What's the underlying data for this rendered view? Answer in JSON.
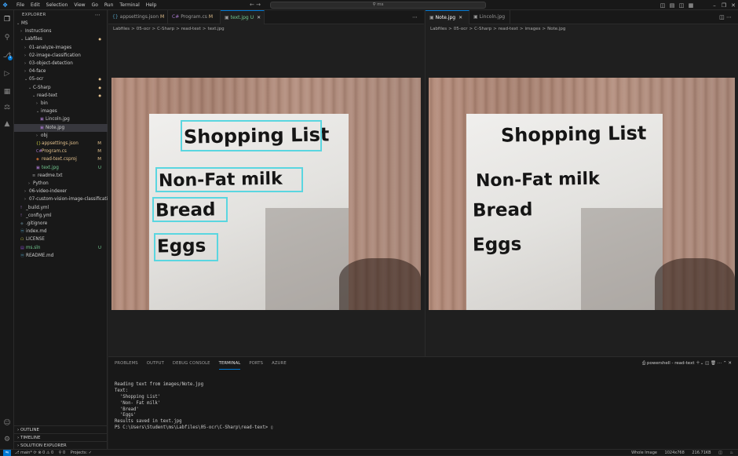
{
  "title_bar": {
    "menu": [
      "File",
      "Edit",
      "Selection",
      "View",
      "Go",
      "Run",
      "Terminal",
      "Help"
    ],
    "search_text": "ms"
  },
  "explorer": {
    "header": "EXPLORER",
    "items": [
      {
        "label": "MS",
        "status": ""
      },
      {
        "label": "Instructions",
        "status": ""
      },
      {
        "label": "Labfiles",
        "status": "●"
      },
      {
        "label": "01-analyze-images",
        "status": ""
      },
      {
        "label": "02-image-classification",
        "status": ""
      },
      {
        "label": "03-object-detection",
        "status": ""
      },
      {
        "label": "04-face",
        "status": ""
      },
      {
        "label": "05-ocr",
        "status": "●"
      },
      {
        "label": "C-Sharp",
        "status": "●"
      },
      {
        "label": "read-text",
        "status": "●"
      },
      {
        "label": "bin",
        "status": ""
      },
      {
        "label": "images",
        "status": ""
      },
      {
        "label": "Lincoln.jpg",
        "status": ""
      },
      {
        "label": "Note.jpg",
        "status": ""
      },
      {
        "label": "obj",
        "status": ""
      },
      {
        "label": "appsettings.json",
        "status": "M"
      },
      {
        "label": "Program.cs",
        "status": "M"
      },
      {
        "label": "read-text.csproj",
        "status": "M"
      },
      {
        "label": "text.jpg",
        "status": "U"
      },
      {
        "label": "readme.txt",
        "status": ""
      },
      {
        "label": "Python",
        "status": ""
      },
      {
        "label": "06-video-indexer",
        "status": ""
      },
      {
        "label": "07-custom-vision-image-classificati...",
        "status": ""
      },
      {
        "label": "_build.yml",
        "status": ""
      },
      {
        "label": "_config.yml",
        "status": ""
      },
      {
        "label": ".gitignore",
        "status": ""
      },
      {
        "label": "index.md",
        "status": ""
      },
      {
        "label": "LICENSE",
        "status": ""
      },
      {
        "label": "ms.sln",
        "status": "U"
      },
      {
        "label": "README.md",
        "status": ""
      }
    ],
    "footer": [
      "OUTLINE",
      "TIMELINE",
      "SOLUTION EXPLORER"
    ]
  },
  "editor_left": {
    "tabs": [
      {
        "label": "appsettings.json",
        "flag": "M"
      },
      {
        "label": "Program.cs",
        "flag": "M"
      },
      {
        "label": "text.jpg",
        "flag": "U"
      }
    ],
    "breadcrumb": [
      "Labfiles",
      ">",
      "05-ocr",
      ">",
      "C-Sharp",
      ">",
      "read-text",
      ">",
      "text.jpg"
    ]
  },
  "editor_right": {
    "tabs": [
      {
        "label": "Note.jpg",
        "flag": ""
      },
      {
        "label": "Lincoln.jpg",
        "flag": ""
      }
    ],
    "breadcrumb": [
      "Labfiles",
      ">",
      "05-ocr",
      ">",
      "C-Sharp",
      ">",
      "read-text",
      ">",
      "images",
      ">",
      "Note.jpg"
    ]
  },
  "note_lines": [
    "Shopping List",
    "Non-Fat milk",
    "Bread",
    "Eggs"
  ],
  "panel": {
    "tabs": [
      "PROBLEMS",
      "OUTPUT",
      "DEBUG CONSOLE",
      "TERMINAL",
      "PORTS",
      "AZURE"
    ],
    "active_tab": "TERMINAL",
    "terminal_label": "powershell - read-text",
    "lines": [
      "Reading text from images/Note.jpg",
      "",
      "Text:",
      "  'Shopping List'",
      "  'Non- Fat milk'",
      "  'Bread'",
      "  'Eggs'",
      "",
      "Results saved in text.jpg",
      "",
      "PS C:\\Users\\Student\\ms\\Labfiles\\05-ocr\\C-Sharp\\read-text> ▯"
    ]
  },
  "status_bar": {
    "branch": "main*",
    "problems": "⊗ 0 ⚠ 0",
    "ports": "⚲ 0",
    "projects": "Projects: ✓",
    "zoom_mode": "Whole Image",
    "dimensions": "1024x768",
    "filesize": "216.71KB"
  },
  "colors": {
    "accent": "#0078d4",
    "bbox": "#5ad6e0",
    "modified": "#e2c08d",
    "untracked": "#73c991"
  }
}
